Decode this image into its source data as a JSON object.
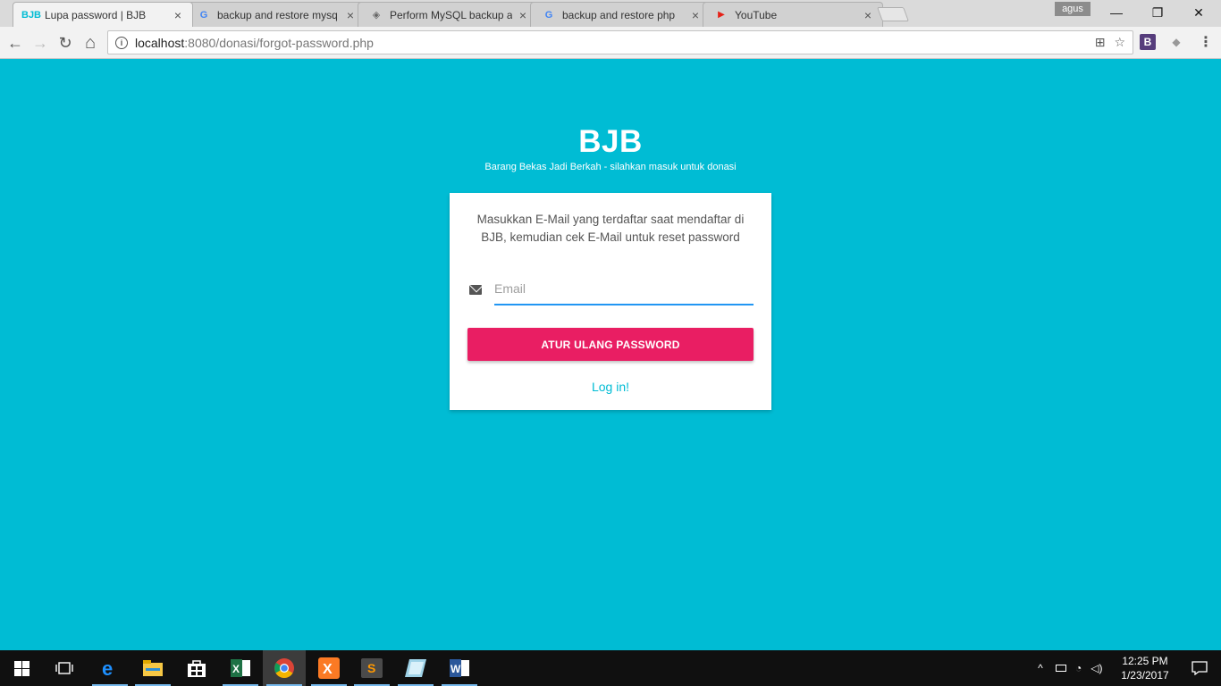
{
  "browser": {
    "tabs": [
      {
        "title": "Lupa password | BJB",
        "favicon": "BJB",
        "favicon_color": "#00bcd4",
        "active": true
      },
      {
        "title": "backup and restore mysq",
        "favicon": "G",
        "favicon_color": "#4285f4",
        "active": false
      },
      {
        "title": "Perform MySQL backup a",
        "favicon": "◈",
        "favicon_color": "#666666",
        "active": false
      },
      {
        "title": "backup and restore php",
        "favicon": "G",
        "favicon_color": "#4285f4",
        "active": false
      },
      {
        "title": "YouTube",
        "favicon": "▶",
        "favicon_color": "#e62117",
        "active": false
      }
    ],
    "user_name": "agus",
    "url_host": "localhost",
    "url_path": ":8080/donasi/forgot-password.php",
    "icons": {
      "back": "←",
      "forward": "→",
      "reload": "↻",
      "home": "⌂",
      "translate": "⊞",
      "bookmark": "☆",
      "extension_b": "B",
      "extension_2": "◆",
      "menu": "⋮",
      "minimize": "—",
      "restore": "❐",
      "close": "✕",
      "tab_close": "×"
    }
  },
  "page": {
    "brand_title": "BJB",
    "brand_subtitle": "Barang Bekas Jadi Berkah - silahkan masuk untuk donasi",
    "instruction": "Masukkan E-Mail yang terdaftar saat mendaftar di BJB, kemudian cek E-Mail untuk reset password",
    "email_placeholder": "Email",
    "email_value": "",
    "submit_label": "ATUR ULANG PASSWORD",
    "login_link": "Log in!",
    "colors": {
      "background": "#00bcd4",
      "button": "#e91e63",
      "input_underline": "#2196f3",
      "link": "#00bcd4"
    }
  },
  "taskbar": {
    "apps": [
      "start",
      "task-view",
      "edge",
      "file-explorer",
      "store",
      "excel",
      "chrome",
      "xampp",
      "sublime-text",
      "app-window",
      "word"
    ],
    "time": "12:25 PM",
    "date": "1/23/2017"
  }
}
